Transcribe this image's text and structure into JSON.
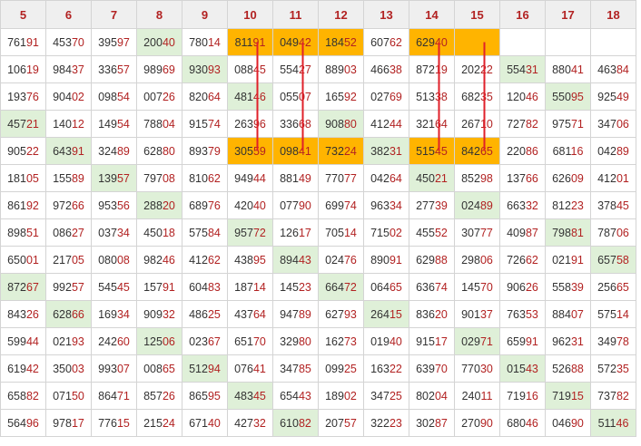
{
  "colors": {
    "header_bg": "#efefef",
    "header_text": "#b22222",
    "digit_lead": "#333333",
    "digit_tail": "#b22222",
    "highlight_green": "#dff0d8",
    "highlight_orange": "#ffb400",
    "connector_line": "#e0202a"
  },
  "columns": [
    "5",
    "6",
    "7",
    "8",
    "9",
    "10",
    "11",
    "12",
    "13",
    "14",
    "15",
    "16",
    "17",
    "18"
  ],
  "rows": [
    [
      {
        "v": "76191"
      },
      {
        "v": "45370"
      },
      {
        "v": "39597"
      },
      {
        "v": "20040",
        "h": "g"
      },
      {
        "v": "78014"
      },
      {
        "v": "81191",
        "h": "o"
      },
      {
        "v": "04942",
        "h": "o"
      },
      {
        "v": "18452",
        "h": "o"
      },
      {
        "v": "60762"
      },
      {
        "v": "62940",
        "h": "o"
      },
      {
        "v": "",
        "h": "o"
      },
      {
        "v": ""
      },
      {
        "v": ""
      },
      {
        "v": ""
      }
    ],
    [
      {
        "v": "10619"
      },
      {
        "v": "98437"
      },
      {
        "v": "33657"
      },
      {
        "v": "98969"
      },
      {
        "v": "93093",
        "h": "g"
      },
      {
        "v": "08845"
      },
      {
        "v": "55427"
      },
      {
        "v": "88903"
      },
      {
        "v": "46638"
      },
      {
        "v": "87219"
      },
      {
        "v": "20222"
      },
      {
        "v": "55431",
        "h": "g"
      },
      {
        "v": "88041"
      },
      {
        "v": "46384"
      }
    ],
    [
      {
        "v": "19376"
      },
      {
        "v": "90402"
      },
      {
        "v": "09854"
      },
      {
        "v": "00726"
      },
      {
        "v": "82064"
      },
      {
        "v": "48146",
        "h": "g"
      },
      {
        "v": "05507"
      },
      {
        "v": "16592"
      },
      {
        "v": "02769"
      },
      {
        "v": "51338"
      },
      {
        "v": "68235"
      },
      {
        "v": "12046"
      },
      {
        "v": "55095",
        "h": "g"
      },
      {
        "v": "92549"
      }
    ],
    [
      {
        "v": "45721",
        "h": "g"
      },
      {
        "v": "14012"
      },
      {
        "v": "14954"
      },
      {
        "v": "78804"
      },
      {
        "v": "91574"
      },
      {
        "v": "26396"
      },
      {
        "v": "33668"
      },
      {
        "v": "90880",
        "h": "g"
      },
      {
        "v": "41244"
      },
      {
        "v": "32164"
      },
      {
        "v": "26710"
      },
      {
        "v": "72782"
      },
      {
        "v": "97571"
      },
      {
        "v": "34706"
      }
    ],
    [
      {
        "v": "90522"
      },
      {
        "v": "64391",
        "h": "g"
      },
      {
        "v": "32489"
      },
      {
        "v": "62880"
      },
      {
        "v": "89379"
      },
      {
        "v": "30559",
        "h": "o"
      },
      {
        "v": "09841",
        "h": "o"
      },
      {
        "v": "73224",
        "h": "o"
      },
      {
        "v": "38231",
        "h": "g"
      },
      {
        "v": "51545",
        "h": "o"
      },
      {
        "v": "84265",
        "h": "o"
      },
      {
        "v": "22086"
      },
      {
        "v": "68116"
      },
      {
        "v": "04289"
      }
    ],
    [
      {
        "v": "18105"
      },
      {
        "v": "15589"
      },
      {
        "v": "13957",
        "h": "g"
      },
      {
        "v": "79708"
      },
      {
        "v": "81062"
      },
      {
        "v": "94944"
      },
      {
        "v": "88149"
      },
      {
        "v": "77077"
      },
      {
        "v": "04264"
      },
      {
        "v": "45021",
        "h": "g"
      },
      {
        "v": "85298"
      },
      {
        "v": "13766"
      },
      {
        "v": "62609"
      },
      {
        "v": "41201"
      }
    ],
    [
      {
        "v": "86192"
      },
      {
        "v": "97266"
      },
      {
        "v": "95356"
      },
      {
        "v": "28820",
        "h": "g"
      },
      {
        "v": "68976"
      },
      {
        "v": "42040"
      },
      {
        "v": "07790"
      },
      {
        "v": "69974"
      },
      {
        "v": "96334"
      },
      {
        "v": "27739"
      },
      {
        "v": "02489",
        "h": "g"
      },
      {
        "v": "66332"
      },
      {
        "v": "81223"
      },
      {
        "v": "37845"
      }
    ],
    [
      {
        "v": "89851"
      },
      {
        "v": "08627"
      },
      {
        "v": "03734"
      },
      {
        "v": "45018"
      },
      {
        "v": "57584"
      },
      {
        "v": "95772",
        "h": "g"
      },
      {
        "v": "12617"
      },
      {
        "v": "70514"
      },
      {
        "v": "71502"
      },
      {
        "v": "45552"
      },
      {
        "v": "30777"
      },
      {
        "v": "40987"
      },
      {
        "v": "79881",
        "h": "g"
      },
      {
        "v": "78706"
      }
    ],
    [
      {
        "v": "65001"
      },
      {
        "v": "21705"
      },
      {
        "v": "08008"
      },
      {
        "v": "98246"
      },
      {
        "v": "41262"
      },
      {
        "v": "43895"
      },
      {
        "v": "89443",
        "h": "g"
      },
      {
        "v": "02476"
      },
      {
        "v": "89091"
      },
      {
        "v": "62988"
      },
      {
        "v": "29806"
      },
      {
        "v": "72662"
      },
      {
        "v": "02191"
      },
      {
        "v": "65758",
        "h": "g"
      }
    ],
    [
      {
        "v": "87267",
        "h": "g"
      },
      {
        "v": "99257"
      },
      {
        "v": "54545"
      },
      {
        "v": "15791"
      },
      {
        "v": "60483"
      },
      {
        "v": "18714"
      },
      {
        "v": "14523"
      },
      {
        "v": "66472",
        "h": "g"
      },
      {
        "v": "06465"
      },
      {
        "v": "63674"
      },
      {
        "v": "14570"
      },
      {
        "v": "90626"
      },
      {
        "v": "55839"
      },
      {
        "v": "25665"
      }
    ],
    [
      {
        "v": "84326"
      },
      {
        "v": "62866",
        "h": "g"
      },
      {
        "v": "16934"
      },
      {
        "v": "90932"
      },
      {
        "v": "48625"
      },
      {
        "v": "43764"
      },
      {
        "v": "94789"
      },
      {
        "v": "62793"
      },
      {
        "v": "26415",
        "h": "g"
      },
      {
        "v": "83620"
      },
      {
        "v": "90137"
      },
      {
        "v": "76353"
      },
      {
        "v": "88407"
      },
      {
        "v": "57514"
      }
    ],
    [
      {
        "v": "59944"
      },
      {
        "v": "02193"
      },
      {
        "v": "24260"
      },
      {
        "v": "12506",
        "h": "g"
      },
      {
        "v": "02367"
      },
      {
        "v": "65170"
      },
      {
        "v": "32980"
      },
      {
        "v": "16273"
      },
      {
        "v": "01940"
      },
      {
        "v": "91517"
      },
      {
        "v": "02971",
        "h": "g"
      },
      {
        "v": "65991"
      },
      {
        "v": "96231"
      },
      {
        "v": "34978"
      }
    ],
    [
      {
        "v": "61942"
      },
      {
        "v": "35003"
      },
      {
        "v": "99307"
      },
      {
        "v": "00865"
      },
      {
        "v": "51294",
        "h": "g"
      },
      {
        "v": "07641"
      },
      {
        "v": "34785"
      },
      {
        "v": "09925"
      },
      {
        "v": "16322"
      },
      {
        "v": "63970"
      },
      {
        "v": "77030"
      },
      {
        "v": "01543",
        "h": "g"
      },
      {
        "v": "52688"
      },
      {
        "v": "57235"
      }
    ],
    [
      {
        "v": "65882"
      },
      {
        "v": "07150"
      },
      {
        "v": "86471"
      },
      {
        "v": "85726"
      },
      {
        "v": "86595"
      },
      {
        "v": "48345",
        "h": "g"
      },
      {
        "v": "65443"
      },
      {
        "v": "18902"
      },
      {
        "v": "34725"
      },
      {
        "v": "80204"
      },
      {
        "v": "24011"
      },
      {
        "v": "71916"
      },
      {
        "v": "71915",
        "h": "g"
      },
      {
        "v": "73782"
      }
    ],
    [
      {
        "v": "56496"
      },
      {
        "v": "97817"
      },
      {
        "v": "77615"
      },
      {
        "v": "21524"
      },
      {
        "v": "67140"
      },
      {
        "v": "42732"
      },
      {
        "v": "61082",
        "h": "g"
      },
      {
        "v": "20757"
      },
      {
        "v": "32223"
      },
      {
        "v": "30287"
      },
      {
        "v": "27090"
      },
      {
        "v": "68046"
      },
      {
        "v": "04690"
      },
      {
        "v": "51146",
        "h": "g"
      }
    ]
  ],
  "connectors": [
    {
      "column": "10",
      "from_row": 1,
      "to_row": 5
    },
    {
      "column": "11",
      "from_row": 1,
      "to_row": 5
    },
    {
      "column": "14",
      "from_row": 1,
      "to_row": 5
    },
    {
      "column": "15",
      "from_row": 1,
      "to_row": 5
    }
  ]
}
